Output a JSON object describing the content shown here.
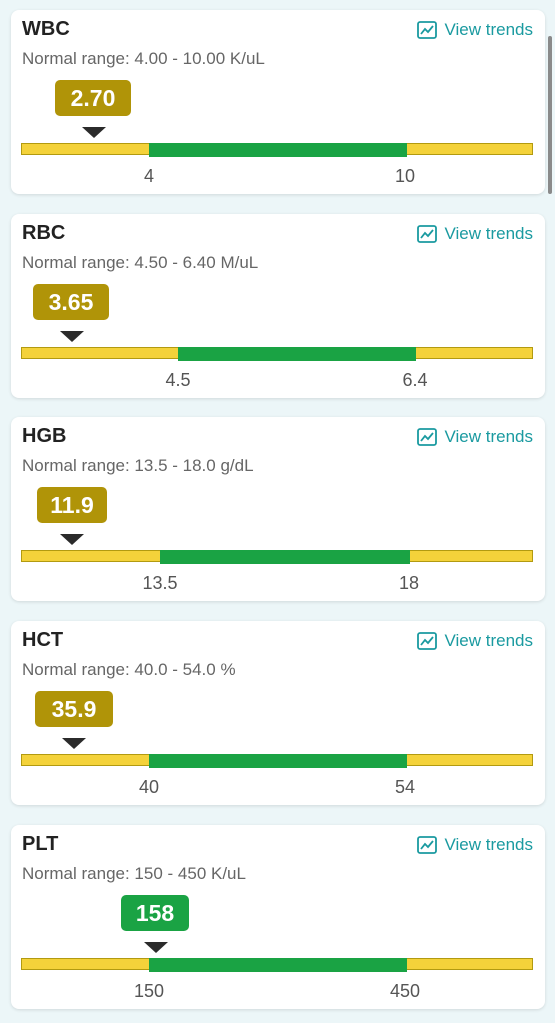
{
  "view_trends_label": "View trends",
  "colors": {
    "low": "#f4d23a",
    "normal": "#1aa344",
    "badge_low": "#b09408",
    "badge_normal": "#1aa344",
    "link": "#1a9aa0"
  },
  "tests": [
    {
      "name": "WBC",
      "range_text": "Normal range: 4.00 - 10.00 K/uL",
      "value": "2.70",
      "status": "low",
      "low": "4",
      "high": "10"
    },
    {
      "name": "RBC",
      "range_text": "Normal range: 4.50 - 6.40 M/uL",
      "value": "3.65",
      "status": "low",
      "low": "4.5",
      "high": "6.4"
    },
    {
      "name": "HGB",
      "range_text": "Normal range: 13.5 - 18.0 g/dL",
      "value": "11.9",
      "status": "low",
      "low": "13.5",
      "high": "18"
    },
    {
      "name": "HCT",
      "range_text": "Normal range: 40.0 - 54.0 %",
      "value": "35.9",
      "status": "low",
      "low": "40",
      "high": "54"
    },
    {
      "name": "PLT",
      "range_text": "Normal range: 150 - 450 K/uL",
      "value": "158",
      "status": "normal",
      "low": "150",
      "high": "450"
    }
  ]
}
